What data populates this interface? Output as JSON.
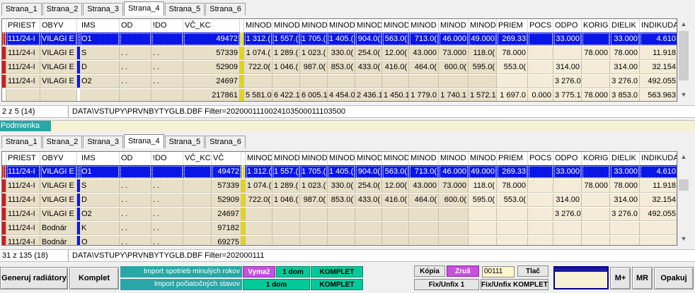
{
  "top_grid": {
    "tabs": [
      "Strana_1",
      "Strana_2",
      "Strana_3",
      "Strana_4",
      "Strana_5",
      "Strana_6"
    ],
    "active_tab": 3,
    "headers": [
      "PRIEST",
      "OBYV",
      "",
      "IMS",
      "OD",
      "!DO",
      "VČ_KC",
      "",
      "MINOD",
      "MINOD",
      "MINOD",
      "MINOD",
      "MINOD",
      "MINOD",
      "MINOD",
      "MINOD",
      "MINOD",
      "PRIEM",
      "POCS",
      "ODPO",
      "KORIG",
      "DIELIK",
      "INDIKUDA"
    ],
    "rows": [
      {
        "c": [
          "111/24-I",
          "VILAGI E",
          "",
          "O1",
          "",
          "",
          "49472",
          "",
          "1 312.(",
          "1 557.(",
          "1 705.(",
          "1 405.(",
          "904.0(",
          "563.0(",
          "713.0(",
          "46.000",
          "49.000",
          "269.33",
          "",
          "33.000",
          "",
          "33.000",
          "4.610"
        ],
        "selected": true,
        "mk": "red"
      },
      {
        "c": [
          "111/24-I",
          "VILAGI E",
          "",
          "S",
          ". .",
          ". .",
          "57339",
          "",
          "1 074.(",
          "1 289.(",
          "1 023.(",
          "330.0(",
          "254.0(",
          "12.00(",
          "43.000",
          "73.000",
          "118.0(",
          "78.000",
          "",
          "",
          "78.000",
          "78.000",
          "11.918"
        ],
        "mk": "red"
      },
      {
        "c": [
          "111/24-I",
          "VILAGI E",
          "",
          "D",
          ". .",
          ". .",
          "52909",
          "",
          "722.0(",
          "1 046.(",
          "987.0(",
          "853.0(",
          "433.0(",
          "416.0(",
          "464.0(",
          "600.0(",
          "595.0(",
          "553.0(",
          "",
          "314.00",
          "",
          "314.00",
          "32.154"
        ],
        "mk": "red"
      },
      {
        "c": [
          "111/24-I",
          "VILAGI E",
          "",
          "O2",
          ". .",
          ". .",
          "24697",
          "",
          "",
          "",
          "",
          "",
          "",
          "",
          "",
          "",
          "",
          "",
          "",
          "3 276.0",
          "",
          "3 276.0",
          "492.055"
        ],
        "mk": "red"
      },
      {
        "c": [
          "",
          "",
          "",
          "",
          "",
          "",
          "217861",
          "",
          "5 581.0",
          "6 422.1",
          "6 005.1",
          "4 454.0",
          "2 436.1",
          "1 450.1",
          "1 779.0",
          "1 740.1",
          "1 572.1",
          "1 697.0",
          "0.000",
          "3 775.1",
          "78.000",
          "3 853.0",
          "563.963"
        ],
        "mk": "none",
        "total": true
      }
    ],
    "status_count": "2 z 5 (14)",
    "status_path": "DATA\\VSTUPY\\PRVNBYTYGLB.DBF Filter=2020001110024103500011103500"
  },
  "condition_label": "Podmienka",
  "bottom_grid": {
    "tabs": [
      "Strana_1",
      "Strana_2",
      "Strana_3",
      "Strana_4",
      "Strana_5",
      "Strana_6"
    ],
    "active_tab": 3,
    "headers": [
      "PRIEST",
      "OBYV",
      "",
      "IMS",
      "OD",
      "!DO",
      "VČ_KC",
      "VČ",
      "",
      "MINOD",
      "MINOD",
      "MINOD",
      "MINOD",
      "MINOD",
      "MINOD",
      "MINOD",
      "MINOD",
      "MINOD",
      "PRIEM",
      "POCS",
      "ODPO",
      "KORIG",
      "DIELIK",
      "INDIKUDA"
    ],
    "rows": [
      {
        "c": [
          "111/24-I",
          "VILAGI E",
          "",
          "O1",
          "",
          "",
          "",
          "49472",
          "",
          "1 312.(",
          "1 557.(",
          "1 705.(",
          "1 405.(",
          "904.0(",
          "563.0(",
          "713.0(",
          "46.000",
          "49.000",
          "269.33",
          "",
          "33.000",
          "",
          "33.000",
          "4.610"
        ],
        "selected": true,
        "mk": "red"
      },
      {
        "c": [
          "111/24-I",
          "VILAGI E",
          "",
          "S",
          ". .",
          ". .",
          "",
          "57339",
          "",
          "1 074.(",
          "1 289.(",
          "1 023.(",
          "330.0(",
          "254.0(",
          "12.00(",
          "43.000",
          "73.000",
          "118.0(",
          "78.000",
          "",
          "",
          "78.000",
          "78.000",
          "11.918"
        ],
        "mk": "red"
      },
      {
        "c": [
          "111/24-I",
          "VILAGI E",
          "",
          "D",
          ". .",
          ". .",
          "",
          "52909",
          "",
          "722.0(",
          "1 046.(",
          "987.0(",
          "853.0(",
          "433.0(",
          "416.0(",
          "464.0(",
          "600.0(",
          "595.0(",
          "553.0(",
          "",
          "314.00",
          "",
          "314.00",
          "32.154"
        ],
        "mk": "red"
      },
      {
        "c": [
          "111/24-I",
          "VILAGI E",
          "",
          "O2",
          ". .",
          ". .",
          "",
          "24697",
          "",
          "",
          "",
          "",
          "",
          "",
          "",
          "",
          "",
          "",
          "",
          "",
          "3 276.0",
          "",
          "3 276.0",
          "492.055"
        ],
        "mk": "red"
      },
      {
        "c": [
          "111/24-I",
          "Bodnár",
          "",
          "K",
          ". .",
          ". .",
          "",
          "97182",
          "",
          "",
          "",
          "",
          "",
          "",
          "",
          "",
          "",
          "",
          "",
          "",
          "",
          "",
          "",
          ""
        ],
        "mk": "red"
      },
      {
        "c": [
          "111/24-I",
          "Bodnár",
          "",
          "O",
          ". .",
          ". .",
          "",
          "69275",
          "",
          "",
          "",
          "",
          "",
          "",
          "",
          "",
          "",
          "",
          "",
          "",
          "",
          "",
          "",
          ""
        ],
        "mk": "red"
      }
    ],
    "status_count": "31 z 135 (18)",
    "status_path": "DATA\\VSTUPY\\PRVNBYTYGLB.DBF Filter=202000111"
  },
  "toolbar": {
    "generate_label": "Generuj radiátory",
    "complete_label": "Komplet",
    "import_prev_label": "Import spotrieb minulých rokov",
    "import_init_label": "Import počiatočných stavov",
    "delete_label": "Vymaž",
    "one_flat_label": "1 dom",
    "complete_btn_label": "KOMPLET",
    "one_flat_label2": "1 dom",
    "complete_btn_label2": "KOMPLET",
    "copy_label": "Kópia",
    "cancel_label": "Zruš",
    "code_value": "00111",
    "print_label": "Tlač",
    "fix_label": "Fix/Unfix 1",
    "fix_all_label": "Fix/Unfix KOMPLET",
    "mplus_label": "M+",
    "mr_label": "MR",
    "repeat_label": "Opakuj",
    "colors": {
      "teal": "#2aa6a6",
      "green": "#00c99a",
      "purple": "#c84fe0",
      "selection": "#0a16e6"
    }
  }
}
